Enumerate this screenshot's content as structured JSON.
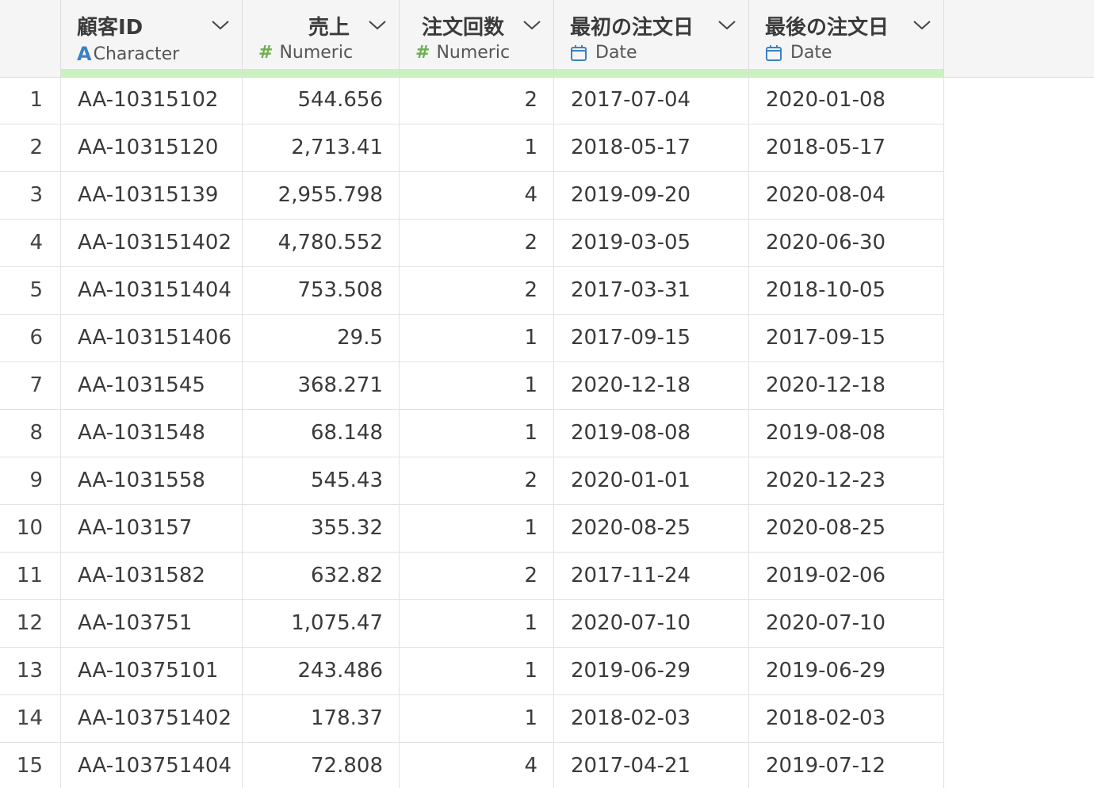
{
  "columns": [
    {
      "name": "顧客ID",
      "type": "Character",
      "type_icon": "character-type-icon",
      "align": "left"
    },
    {
      "name": "売上",
      "type": "Numeric",
      "type_icon": "numeric-type-icon",
      "align": "right"
    },
    {
      "name": "注文回数",
      "type": "Numeric",
      "type_icon": "numeric-type-icon",
      "align": "right"
    },
    {
      "name": "最初の注文日",
      "type": "Date",
      "type_icon": "calendar-icon",
      "align": "left"
    },
    {
      "name": "最後の注文日",
      "type": "Date",
      "type_icon": "calendar-icon",
      "align": "left"
    }
  ],
  "rows": [
    {
      "n": "1",
      "cells": [
        "AA-10315102",
        "544.656",
        "2",
        "2017-07-04",
        "2020-01-08"
      ]
    },
    {
      "n": "2",
      "cells": [
        "AA-10315120",
        "2,713.41",
        "1",
        "2018-05-17",
        "2018-05-17"
      ]
    },
    {
      "n": "3",
      "cells": [
        "AA-10315139",
        "2,955.798",
        "4",
        "2019-09-20",
        "2020-08-04"
      ]
    },
    {
      "n": "4",
      "cells": [
        "AA-103151402",
        "4,780.552",
        "2",
        "2019-03-05",
        "2020-06-30"
      ]
    },
    {
      "n": "5",
      "cells": [
        "AA-103151404",
        "753.508",
        "2",
        "2017-03-31",
        "2018-10-05"
      ]
    },
    {
      "n": "6",
      "cells": [
        "AA-103151406",
        "29.5",
        "1",
        "2017-09-15",
        "2017-09-15"
      ]
    },
    {
      "n": "7",
      "cells": [
        "AA-1031545",
        "368.271",
        "1",
        "2020-12-18",
        "2020-12-18"
      ]
    },
    {
      "n": "8",
      "cells": [
        "AA-1031548",
        "68.148",
        "1",
        "2019-08-08",
        "2019-08-08"
      ]
    },
    {
      "n": "9",
      "cells": [
        "AA-1031558",
        "545.43",
        "2",
        "2020-01-01",
        "2020-12-23"
      ]
    },
    {
      "n": "10",
      "cells": [
        "AA-103157",
        "355.32",
        "1",
        "2020-08-25",
        "2020-08-25"
      ]
    },
    {
      "n": "11",
      "cells": [
        "AA-1031582",
        "632.82",
        "2",
        "2017-11-24",
        "2019-02-06"
      ]
    },
    {
      "n": "12",
      "cells": [
        "AA-103751",
        "1,075.47",
        "1",
        "2020-07-10",
        "2020-07-10"
      ]
    },
    {
      "n": "13",
      "cells": [
        "AA-10375101",
        "243.486",
        "1",
        "2019-06-29",
        "2019-06-29"
      ]
    },
    {
      "n": "14",
      "cells": [
        "AA-103751402",
        "178.37",
        "1",
        "2018-02-03",
        "2018-02-03"
      ]
    },
    {
      "n": "15",
      "cells": [
        "AA-103751404",
        "72.808",
        "4",
        "2017-04-21",
        "2019-07-12"
      ]
    }
  ],
  "colors": {
    "quality_bar": "#c9f2c0",
    "character_icon": "#3b82c4",
    "numeric_icon": "#6ab04c",
    "date_icon": "#3b82c4"
  }
}
